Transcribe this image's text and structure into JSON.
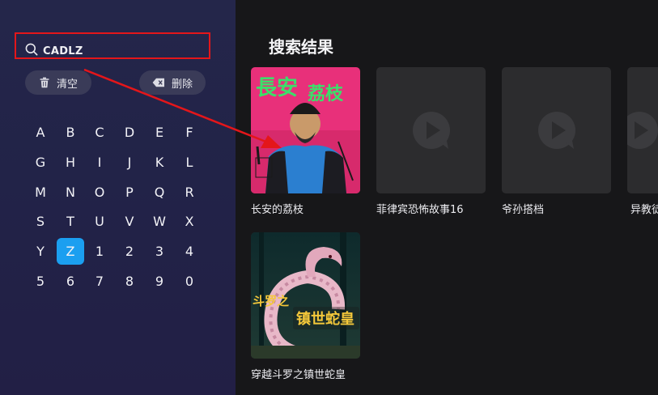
{
  "search": {
    "query": "CADLZ",
    "search_icon": "search-icon"
  },
  "actions": {
    "clear_label": "清空",
    "clear_icon": "trash-icon",
    "delete_label": "删除",
    "delete_icon": "backspace-icon"
  },
  "keyboard": {
    "rows": [
      [
        "A",
        "B",
        "C",
        "D",
        "E",
        "F"
      ],
      [
        "G",
        "H",
        "I",
        "J",
        "K",
        "L"
      ],
      [
        "M",
        "N",
        "O",
        "P",
        "Q",
        "R"
      ],
      [
        "S",
        "T",
        "U",
        "V",
        "W",
        "X"
      ],
      [
        "Y",
        "Z",
        "1",
        "2",
        "3",
        "4"
      ],
      [
        "5",
        "6",
        "7",
        "8",
        "9",
        "0"
      ]
    ],
    "selected_key": "Z",
    "selected_color": "#1b9ff0"
  },
  "results": {
    "title": "搜索结果",
    "items": [
      {
        "title": "长安的荔枝",
        "poster": "image"
      },
      {
        "title": "菲律宾恐怖故事16",
        "poster": "play-placeholder-icon"
      },
      {
        "title": "爷孙搭档",
        "poster": "play-placeholder-icon"
      },
      {
        "title": "异教徒",
        "poster": "play-placeholder-icon"
      },
      {
        "title": "穿越斗罗之镇世蛇皇",
        "poster": "image"
      }
    ]
  },
  "annotation": {
    "box_color": "#e4161a",
    "arrow_color": "#e4161a"
  }
}
